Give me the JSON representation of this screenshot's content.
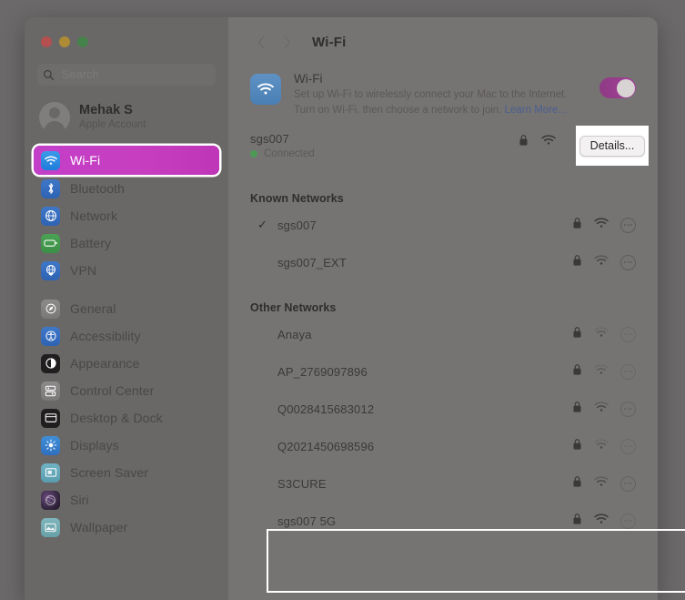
{
  "window": {
    "traffic_lights": [
      {
        "name": "close",
        "color": "#b4504f"
      },
      {
        "name": "minimize",
        "color": "#ae8c35"
      },
      {
        "name": "maximize",
        "color": "#46824c"
      }
    ]
  },
  "sidebar": {
    "search": {
      "placeholder": "Search",
      "icon": "search-icon"
    },
    "account": {
      "name": "Mehak S",
      "subtitle": "Apple Account"
    },
    "groups": [
      {
        "items": [
          {
            "label": "Wi-Fi",
            "icon": "wifi-icon",
            "selected": true
          },
          {
            "label": "Bluetooth",
            "icon": "bluetooth-icon",
            "selected": false
          },
          {
            "label": "Network",
            "icon": "network-icon",
            "selected": false
          },
          {
            "label": "Battery",
            "icon": "battery-icon",
            "selected": false
          },
          {
            "label": "VPN",
            "icon": "vpn-icon",
            "selected": false
          }
        ]
      },
      {
        "items": [
          {
            "label": "General",
            "icon": "general-icon",
            "selected": false
          },
          {
            "label": "Accessibility",
            "icon": "accessibility-icon",
            "selected": false
          },
          {
            "label": "Appearance",
            "icon": "appearance-icon",
            "selected": false
          },
          {
            "label": "Control Center",
            "icon": "control-center-icon",
            "selected": false
          },
          {
            "label": "Desktop & Dock",
            "icon": "desktop-dock-icon",
            "selected": false
          },
          {
            "label": "Displays",
            "icon": "displays-icon",
            "selected": false
          },
          {
            "label": "Screen Saver",
            "icon": "screen-saver-icon",
            "selected": false
          },
          {
            "label": "Siri",
            "icon": "siri-icon",
            "selected": false
          },
          {
            "label": "Wallpaper",
            "icon": "wallpaper-icon",
            "selected": false
          }
        ]
      }
    ]
  },
  "content": {
    "toolbar": {
      "back_icon": "chevron-left-icon",
      "forward_icon": "chevron-right-icon",
      "title": "Wi-Fi"
    },
    "hero": {
      "icon": "wifi-icon",
      "title": "Wi-Fi",
      "description": "Set up Wi-Fi to wirelessly connect your Mac to the Internet. Turn on Wi-Fi, then choose a network to join. ",
      "link_label": "Learn More...",
      "toggle_on": true,
      "toggle_color": "#a4419a"
    },
    "connected": {
      "ssid": "sgs007",
      "status": "Connected",
      "status_color": "#4d9a57",
      "lock_icon": "lock-icon",
      "wifi_icon": "wifi-signal-icon",
      "details_button": "Details..."
    },
    "known_networks": {
      "heading": "Known Networks",
      "rows": [
        {
          "ssid": "sgs007",
          "checked": true,
          "lock": true,
          "signal": "strong",
          "more": "more-options-icon"
        },
        {
          "ssid": "sgs007_EXT",
          "checked": false,
          "lock": true,
          "signal": "strong",
          "more": "more-options-icon"
        }
      ]
    },
    "other_networks": {
      "heading": "Other Networks",
      "rows": [
        {
          "ssid": "Anaya",
          "checked": false,
          "lock": true,
          "signal": "weak",
          "more": "more-options-icon"
        },
        {
          "ssid": "AP_2769097896",
          "checked": false,
          "lock": true,
          "signal": "weak",
          "more": "more-options-icon"
        },
        {
          "ssid": "Q0028415683012",
          "checked": false,
          "lock": true,
          "signal": "medium",
          "more": "more-options-icon"
        },
        {
          "ssid": "Q2021450698596",
          "checked": false,
          "lock": true,
          "signal": "weak",
          "more": "more-options-icon"
        },
        {
          "ssid": "S3CURE",
          "checked": false,
          "lock": true,
          "signal": "medium",
          "more": "more-options-icon"
        },
        {
          "ssid": "sgs007 5G",
          "checked": false,
          "lock": true,
          "signal": "strong",
          "more": "more-options-icon"
        }
      ]
    }
  },
  "highlights": [
    {
      "name": "details-button-highlight",
      "target": "Details..."
    },
    {
      "name": "bottom-region-highlight",
      "target": "sgs007 5G"
    }
  ]
}
